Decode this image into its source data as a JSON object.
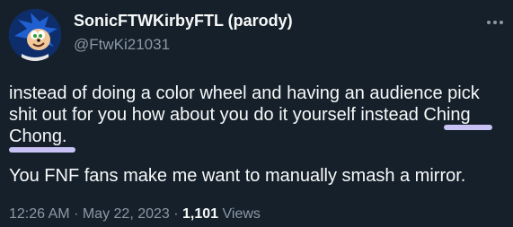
{
  "author": {
    "display_name": "SonicFTWKirbyFTL (parody)",
    "handle": "@FtwKi21031",
    "avatar_icon": "sonic-avatar-icon"
  },
  "tweet": {
    "paragraph_1": "instead of doing a color wheel and having an audience pick shit out for you how about you do it yourself instead Ching Chong.",
    "paragraph_2": "You FNF fans make me want to manually smash a mirror."
  },
  "meta": {
    "time": "12:26 AM",
    "separator_1": "·",
    "date": "May 22, 2023",
    "separator_2": "·",
    "views_count": "1,101",
    "views_label": "Views"
  },
  "colors": {
    "background": "#15202b",
    "text_primary": "#f7f9f9",
    "text_secondary": "#8b98a5",
    "annotation_underline": "#c7c2f3"
  },
  "icons": {
    "more": "more-icon"
  }
}
